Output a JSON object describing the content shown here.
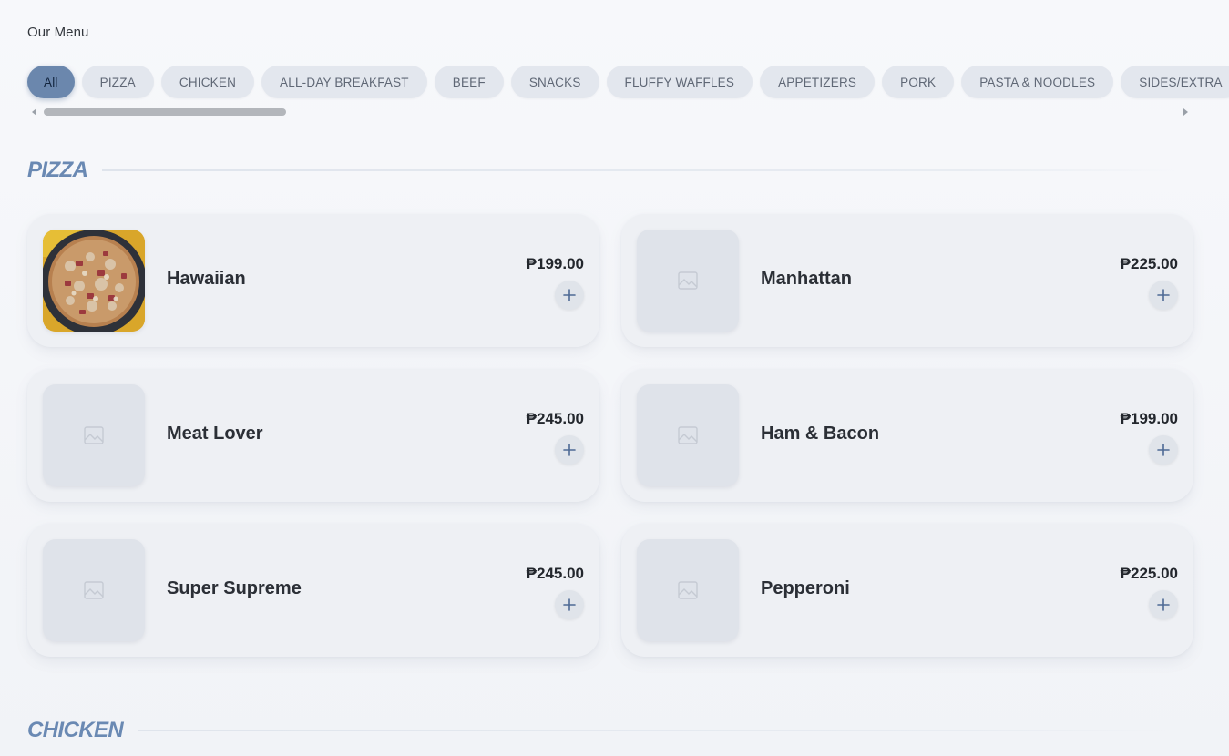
{
  "header": {
    "title": "Our Menu"
  },
  "categories": [
    "All",
    "PIZZA",
    "CHICKEN",
    "ALL-DAY BREAKFAST",
    "BEEF",
    "SNACKS",
    "FLUFFY WAFFLES",
    "APPETIZERS",
    "PORK",
    "PASTA & NOODLES",
    "SIDES/EXTRA"
  ],
  "active_category": "All",
  "sections": [
    {
      "title": "PIZZA",
      "items": [
        {
          "name": "Hawaiian",
          "price": "₱199.00",
          "has_photo": true,
          "add_icon": "plus-icon"
        },
        {
          "name": "Manhattan",
          "price": "₱225.00",
          "has_photo": false,
          "add_icon": "plus-icon"
        },
        {
          "name": "Meat Lover",
          "price": "₱245.00",
          "has_photo": false,
          "add_icon": "plus-icon"
        },
        {
          "name": "Ham & Bacon",
          "price": "₱199.00",
          "has_photo": false,
          "add_icon": "plus-icon"
        },
        {
          "name": "Super Supreme",
          "price": "₱245.00",
          "has_photo": false,
          "add_icon": "plus-icon"
        },
        {
          "name": "Pepperoni",
          "price": "₱225.00",
          "has_photo": false,
          "add_icon": "plus-icon"
        }
      ]
    },
    {
      "title": "CHICKEN",
      "items": []
    }
  ],
  "colors": {
    "accent": "#6b87ad",
    "section_title": "#6a89b3",
    "chip_bg": "#e3e7ee",
    "card_bg": "#eef0f4"
  }
}
